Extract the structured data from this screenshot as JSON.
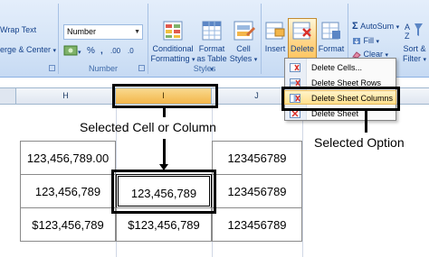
{
  "ribbon": {
    "wrap_text": "Wrap Text",
    "merge_center": "erge & Center",
    "number_format": "Number",
    "number_group": "Number",
    "percent_symbol": "%",
    "comma_symbol": ",",
    "inc_decimal": ".00",
    "dec_decimal": ".0",
    "conditional_formatting": [
      "Conditional",
      "Formatting"
    ],
    "format_as_table": [
      "Format",
      "as Table"
    ],
    "cell_styles": [
      "Cell",
      "Styles"
    ],
    "styles_group": "Styles",
    "insert": "Insert",
    "delete": "Delete",
    "format": "Format",
    "autosum": "AutoSum",
    "fill": "Fill",
    "clear": "Clear",
    "sort_filter": [
      "Sort &",
      "Filter"
    ],
    "sigma_symbol": "Σ"
  },
  "delete_menu": {
    "items": [
      {
        "label": "Delete Cells..."
      },
      {
        "label": "Delete Sheet Rows"
      },
      {
        "label": "Delete Sheet Columns"
      },
      {
        "label": "Delete Sheet"
      }
    ]
  },
  "sheet": {
    "columns": [
      "H",
      "I",
      "J"
    ],
    "rows": [
      [
        "123,456,789.00",
        "123456789"
      ],
      [
        "123,456,789",
        "123,456,789",
        "123456789"
      ],
      [
        "$123,456,789",
        "$123,456,789",
        "123456789"
      ]
    ]
  },
  "annotations": {
    "selected_cell_or_column": "Selected Cell or Column",
    "selected_option": "Selected Option"
  },
  "colors": {
    "ribbon_bg": "#d6e5f7",
    "highlight": "#ffd68a",
    "selected_column_header": "#f3b64a"
  }
}
